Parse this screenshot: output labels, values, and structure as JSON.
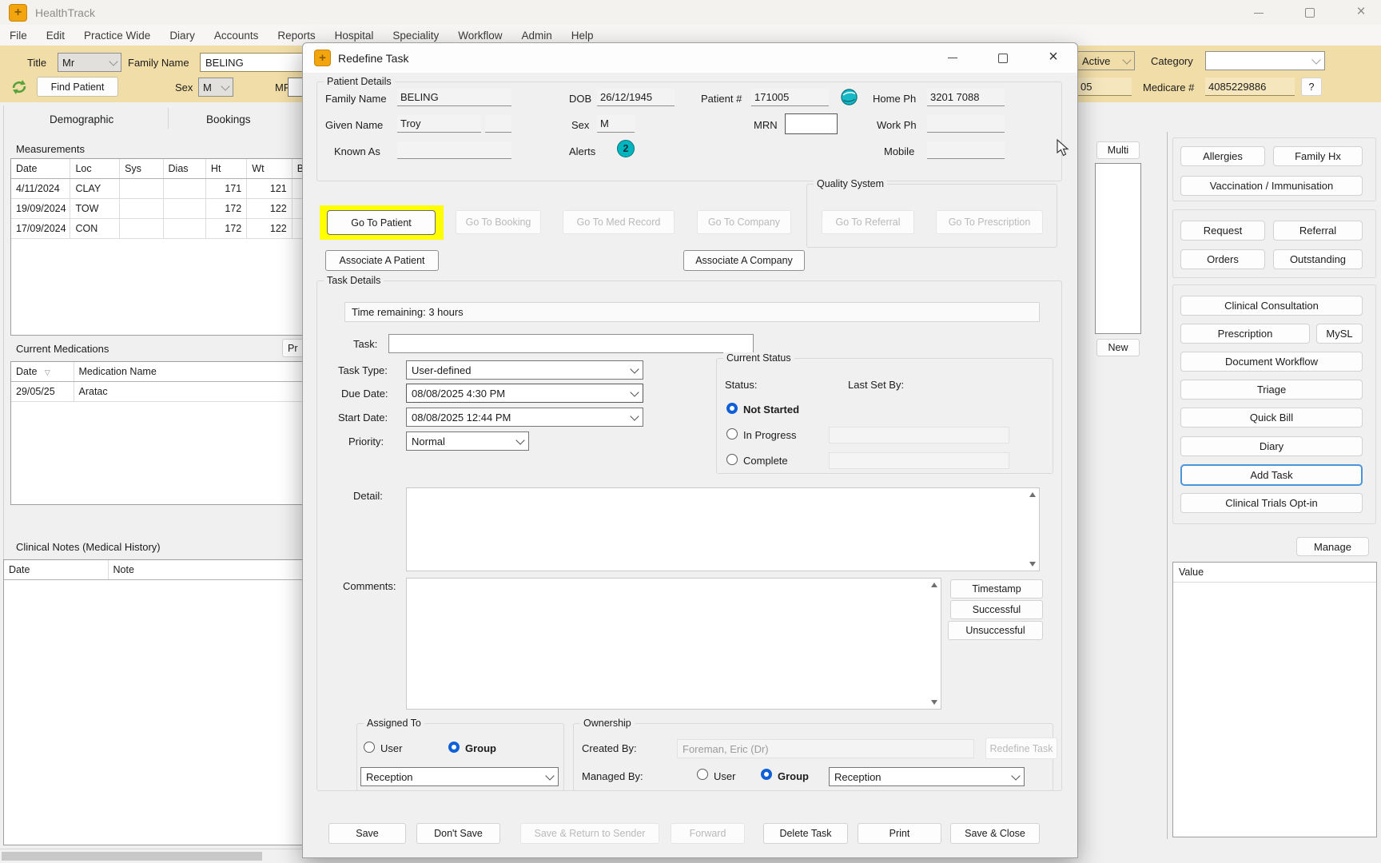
{
  "app": {
    "title": "HealthTrack"
  },
  "menu": {
    "items": [
      "File",
      "Edit",
      "Practice Wide",
      "Diary",
      "Accounts",
      "Reports",
      "Hospital",
      "Speciality",
      "Workflow",
      "Admin",
      "Help"
    ]
  },
  "toolbar": {
    "title_label": "Title",
    "title_value": "Mr",
    "family_name_label": "Family Name",
    "family_name_value": "BELING",
    "find_patient_label": "Find Patient",
    "sex_label": "Sex",
    "sex_value": "M",
    "mrn_label": "MRN",
    "active_value": "Active",
    "category_label": "Category",
    "patient_no_partial": "05",
    "medicare_label": "Medicare #",
    "medicare_value": "4085229886",
    "help_label": "?"
  },
  "tabs": {
    "demographic": "Demographic",
    "bookings": "Bookings"
  },
  "left_panel": {
    "measurements": {
      "title": "Measurements",
      "columns": [
        "Date",
        "Loc",
        "Sys",
        "Dias",
        "Ht",
        "Wt",
        "BM"
      ],
      "rows": [
        [
          "4/11/2024",
          "CLAY",
          "",
          "",
          "171",
          "121",
          ""
        ],
        [
          "19/09/2024",
          "TOW",
          "",
          "",
          "172",
          "122",
          ""
        ],
        [
          "17/09/2024",
          "CON",
          "",
          "",
          "172",
          "122",
          ""
        ]
      ]
    },
    "medications": {
      "title": "Current Medications",
      "partial_button": "Pr",
      "columns": [
        "Date",
        "Medication Name"
      ],
      "rows": [
        [
          "29/05/25",
          "Aratac"
        ]
      ]
    },
    "clinical_notes": {
      "title": "Clinical Notes (Medical History)",
      "columns": [
        "Date",
        "Note"
      ]
    }
  },
  "middle_strip": {
    "multi": "Multi",
    "new": "New"
  },
  "sidebar": {
    "group1": [
      "Allergies",
      "Family Hx",
      "Vaccination / Immunisation"
    ],
    "group2": [
      "Request",
      "Referral",
      "Orders",
      "Outstanding"
    ],
    "group3": [
      "Clinical Consultation",
      "Prescription",
      "MySL",
      "Document Workflow",
      "Triage",
      "Quick Bill",
      "Diary",
      "Add Task",
      "Clinical Trials Opt-in"
    ],
    "manage": "Manage",
    "value_header": "Value"
  },
  "dialog": {
    "title": "Redefine Task",
    "patient_details": {
      "legend": "Patient Details",
      "family_name_label": "Family Name",
      "family_name": "BELING",
      "dob_label": "DOB",
      "dob": "26/12/1945",
      "patient_no_label": "Patient #",
      "patient_no": "171005",
      "home_ph_label": "Home Ph",
      "home_ph": "3201 7088",
      "given_name_label": "Given Name",
      "given_name": "Troy",
      "sex_label": "Sex",
      "sex": "M",
      "mrn_label": "MRN",
      "work_ph_label": "Work Ph",
      "known_as_label": "Known As",
      "alerts_label": "Alerts",
      "alerts_count": "2",
      "mobile_label": "Mobile"
    },
    "nav_buttons": {
      "go_to_patient": "Go To Patient",
      "go_to_booking": "Go To Booking",
      "go_to_med_record": "Go To Med Record",
      "go_to_company": "Go To Company"
    },
    "quality_system": {
      "legend": "Quality System",
      "go_to_referral": "Go To Referral",
      "go_to_prescription": "Go To Prescription"
    },
    "associate_patient": "Associate A Patient",
    "associate_company": "Associate A Company",
    "task_details": {
      "legend": "Task Details",
      "time_remaining": "Time remaining: 3 hours",
      "task_label": "Task:",
      "task_type_label": "Task Type:",
      "task_type": "User-defined",
      "due_date_label": "Due Date:",
      "due_date": "08/08/2025  4:30 PM",
      "start_date_label": "Start Date:",
      "start_date": "08/08/2025  12:44 PM",
      "priority_label": "Priority:",
      "priority": "Normal",
      "detail_label": "Detail:",
      "comments_label": "Comments:",
      "current_status": {
        "legend": "Current Status",
        "status_label": "Status:",
        "last_set_by_label": "Last Set By:",
        "options": [
          "Not Started",
          "In Progress",
          "Complete"
        ],
        "selected": "Not Started"
      },
      "comment_buttons": [
        "Timestamp",
        "Successful",
        "Unsuccessful"
      ],
      "assigned_to": {
        "legend": "Assigned To",
        "user": "User",
        "group": "Group",
        "value": "Reception"
      },
      "ownership": {
        "legend": "Ownership",
        "created_by_label": "Created By:",
        "created_by": "Foreman, Eric (Dr)",
        "redefine_task": "Redefine Task",
        "managed_by_label": "Managed By:",
        "user": "User",
        "group": "Group",
        "value": "Reception"
      }
    },
    "footer_buttons": {
      "save": "Save",
      "dont_save": "Don't Save",
      "save_return": "Save & Return to Sender",
      "forward": "Forward",
      "delete_task": "Delete Task",
      "print": "Print",
      "save_close": "Save & Close"
    }
  },
  "colors": {
    "accent_blue": "#0f5fd7",
    "highlight_yellow": "#ffff00",
    "teal": "#00b5bd",
    "tan": "#f1dda7"
  }
}
